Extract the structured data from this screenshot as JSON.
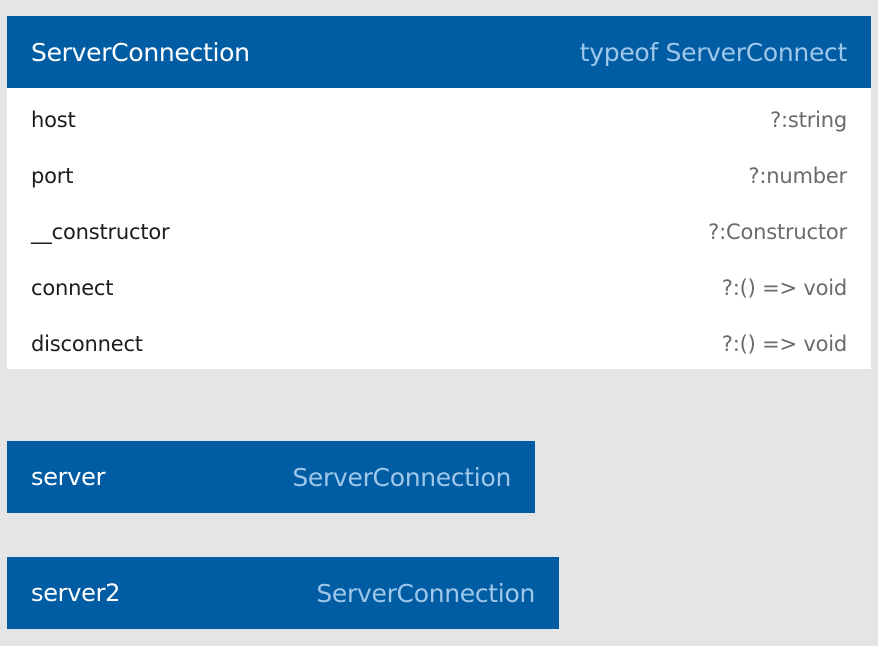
{
  "class_box": {
    "name": "ServerConnection",
    "type": "typeof ServerConnect",
    "members": [
      {
        "name": "host",
        "type": "?:string"
      },
      {
        "name": "port",
        "type": "?:number"
      },
      {
        "name": "__constructor",
        "type": "?:Constructor"
      },
      {
        "name": "connect",
        "type": "?:() => void"
      },
      {
        "name": "disconnect",
        "type": "?:() => void"
      }
    ]
  },
  "instances": [
    {
      "name": "server",
      "type": "ServerConnection"
    },
    {
      "name": "server2",
      "type": "ServerConnection"
    }
  ],
  "colors": {
    "background": "#e5e5e5",
    "header": "#005ca3",
    "header_text": "#ffffff",
    "header_type_text": "#9ec7ea",
    "member_name_text": "#1c1c1c",
    "member_type_text": "#6b6b6b"
  }
}
